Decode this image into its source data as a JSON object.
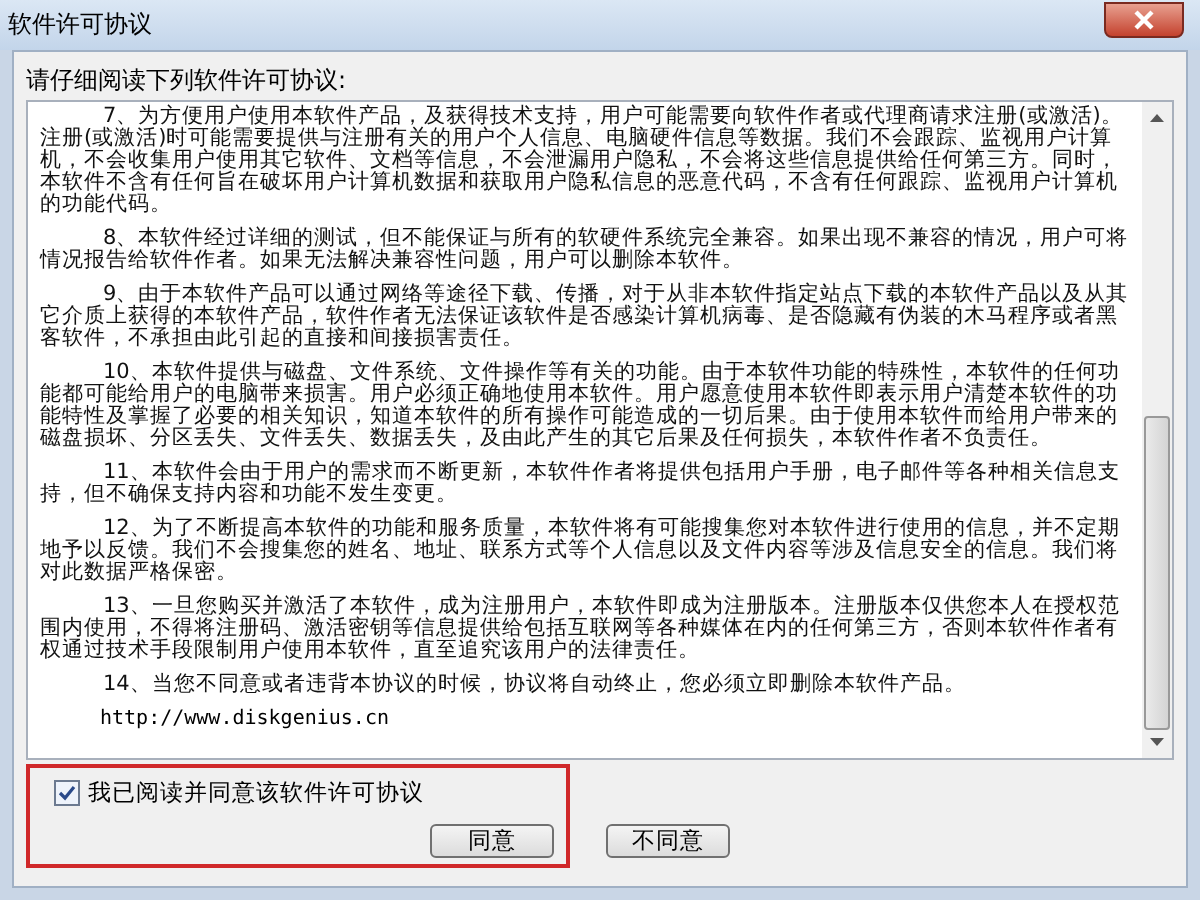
{
  "window": {
    "title": "软件许可协议"
  },
  "prompt": "请仔细阅读下列软件许可协议:",
  "agreement": {
    "paragraphs": [
      "7、为方便用户使用本软件产品，及获得技术支持，用户可能需要向软件作者或代理商请求注册(或激活)。注册(或激活)时可能需要提供与注册有关的用户个人信息、电脑硬件信息等数据。我们不会跟踪、监视用户计算机，不会收集用户使用其它软件、文档等信息，不会泄漏用户隐私，不会将这些信息提供给任何第三方。同时，本软件不含有任何旨在破坏用户计算机数据和获取用户隐私信息的恶意代码，不含有任何跟踪、监视用户计算机的功能代码。",
      "8、本软件经过详细的测试，但不能保证与所有的软硬件系统完全兼容。如果出现不兼容的情况，用户可将情况报告给软件作者。如果无法解决兼容性问题，用户可以删除本软件。",
      "9、由于本软件产品可以通过网络等途径下载、传播，对于从非本软件指定站点下载的本软件产品以及从其它介质上获得的本软件产品，软件作者无法保证该软件是否感染计算机病毒、是否隐藏有伪装的木马程序或者黑客软件，不承担由此引起的直接和间接损害责任。",
      "10、本软件提供与磁盘、文件系统、文件操作等有关的功能。由于本软件功能的特殊性，本软件的任何功能都可能给用户的电脑带来损害。用户必须正确地使用本软件。用户愿意使用本软件即表示用户清楚本软件的功能特性及掌握了必要的相关知识，知道本软件的所有操作可能造成的一切后果。由于使用本软件而给用户带来的磁盘损坏、分区丢失、文件丢失、数据丢失，及由此产生的其它后果及任何损失，本软件作者不负责任。",
      "11、本软件会由于用户的需求而不断更新，本软件作者将提供包括用户手册，电子邮件等各种相关信息支持，但不确保支持内容和功能不发生变更。",
      "12、为了不断提高本软件的功能和服务质量，本软件将有可能搜集您对本软件进行使用的信息，并不定期地予以反馈。我们不会搜集您的姓名、地址、联系方式等个人信息以及文件内容等涉及信息安全的信息。我们将对此数据严格保密。",
      "13、一旦您购买并激活了本软件，成为注册用户，本软件即成为注册版本。注册版本仅供您本人在授权范围内使用，不得将注册码、激活密钥等信息提供给包括互联网等各种媒体在内的任何第三方，否则本软件作者有权通过技术手段限制用户使用本软件，直至追究该用户的法律责任。",
      "14、当您不同意或者违背本协议的时候，协议将自动终止，您必须立即删除本软件产品。"
    ],
    "url": "http://www.diskgenius.cn"
  },
  "accept_checkbox": {
    "label": "我已阅读并同意该软件许可协议",
    "checked": true
  },
  "buttons": [
    {
      "label": "同意"
    },
    {
      "label": "不同意"
    }
  ]
}
